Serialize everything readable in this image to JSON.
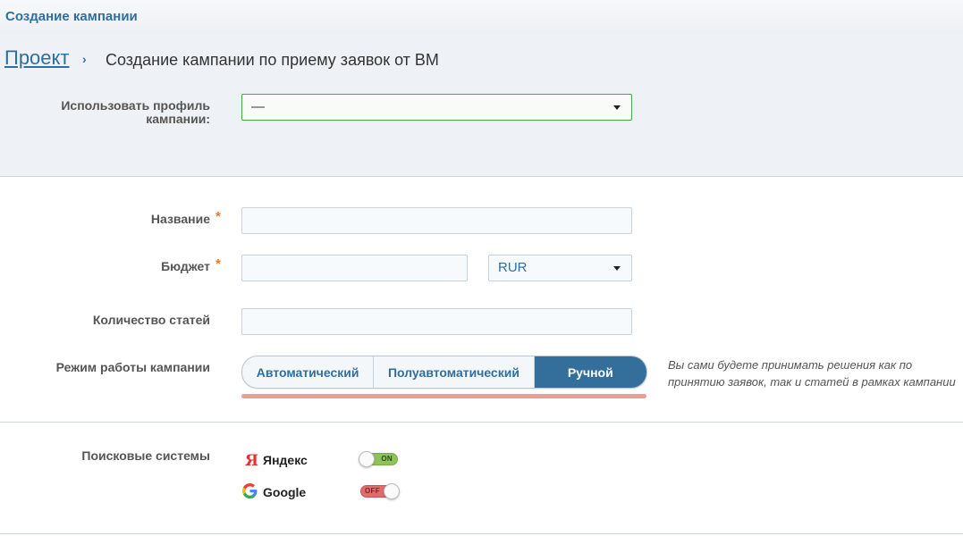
{
  "window": {
    "title": "Создание кампании"
  },
  "breadcrumb": {
    "link": "Проект",
    "separator": "›",
    "current": "Создание кампании по приему заявок от ВМ"
  },
  "profile": {
    "label": "Использовать профиль кампании:",
    "value": "—"
  },
  "form": {
    "name_label": "Название",
    "name_value": "",
    "budget_label": "Бюджет",
    "budget_value": "",
    "currency": "RUR",
    "articles_label": "Количество статей",
    "articles_value": "",
    "required_mark": "*"
  },
  "mode": {
    "label": "Режим работы кампании",
    "options": [
      "Автоматический",
      "Полуавтоматический",
      "Ручной"
    ],
    "selected": "Ручной",
    "hint": "Вы сами будете принимать решения как по принятию заявок, так и статей в рамках кампании"
  },
  "search": {
    "label": "Поисковые системы",
    "engines": [
      {
        "name": "Яндекс",
        "state": "ON",
        "enabled": true
      },
      {
        "name": "Google",
        "state": "OFF",
        "enabled": false
      }
    ]
  },
  "colors": {
    "accent": "#346f9c",
    "link": "#2f6f9f",
    "required": "#e8792a",
    "on": "#8fc35a",
    "off": "#e06b6b"
  }
}
